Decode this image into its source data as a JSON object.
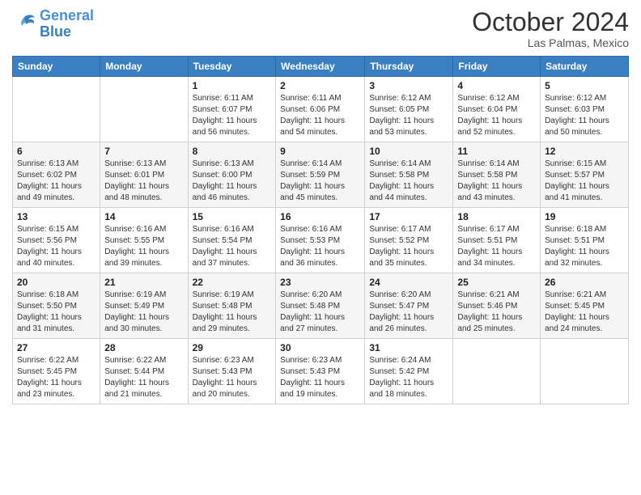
{
  "header": {
    "logo_line1": "General",
    "logo_line2": "Blue",
    "month": "October 2024",
    "location": "Las Palmas, Mexico"
  },
  "weekdays": [
    "Sunday",
    "Monday",
    "Tuesday",
    "Wednesday",
    "Thursday",
    "Friday",
    "Saturday"
  ],
  "weeks": [
    [
      {
        "day": "",
        "sunrise": "",
        "sunset": "",
        "daylight": ""
      },
      {
        "day": "",
        "sunrise": "",
        "sunset": "",
        "daylight": ""
      },
      {
        "day": "1",
        "sunrise": "Sunrise: 6:11 AM",
        "sunset": "Sunset: 6:07 PM",
        "daylight": "Daylight: 11 hours and 56 minutes."
      },
      {
        "day": "2",
        "sunrise": "Sunrise: 6:11 AM",
        "sunset": "Sunset: 6:06 PM",
        "daylight": "Daylight: 11 hours and 54 minutes."
      },
      {
        "day": "3",
        "sunrise": "Sunrise: 6:12 AM",
        "sunset": "Sunset: 6:05 PM",
        "daylight": "Daylight: 11 hours and 53 minutes."
      },
      {
        "day": "4",
        "sunrise": "Sunrise: 6:12 AM",
        "sunset": "Sunset: 6:04 PM",
        "daylight": "Daylight: 11 hours and 52 minutes."
      },
      {
        "day": "5",
        "sunrise": "Sunrise: 6:12 AM",
        "sunset": "Sunset: 6:03 PM",
        "daylight": "Daylight: 11 hours and 50 minutes."
      }
    ],
    [
      {
        "day": "6",
        "sunrise": "Sunrise: 6:13 AM",
        "sunset": "Sunset: 6:02 PM",
        "daylight": "Daylight: 11 hours and 49 minutes."
      },
      {
        "day": "7",
        "sunrise": "Sunrise: 6:13 AM",
        "sunset": "Sunset: 6:01 PM",
        "daylight": "Daylight: 11 hours and 48 minutes."
      },
      {
        "day": "8",
        "sunrise": "Sunrise: 6:13 AM",
        "sunset": "Sunset: 6:00 PM",
        "daylight": "Daylight: 11 hours and 46 minutes."
      },
      {
        "day": "9",
        "sunrise": "Sunrise: 6:14 AM",
        "sunset": "Sunset: 5:59 PM",
        "daylight": "Daylight: 11 hours and 45 minutes."
      },
      {
        "day": "10",
        "sunrise": "Sunrise: 6:14 AM",
        "sunset": "Sunset: 5:58 PM",
        "daylight": "Daylight: 11 hours and 44 minutes."
      },
      {
        "day": "11",
        "sunrise": "Sunrise: 6:14 AM",
        "sunset": "Sunset: 5:58 PM",
        "daylight": "Daylight: 11 hours and 43 minutes."
      },
      {
        "day": "12",
        "sunrise": "Sunrise: 6:15 AM",
        "sunset": "Sunset: 5:57 PM",
        "daylight": "Daylight: 11 hours and 41 minutes."
      }
    ],
    [
      {
        "day": "13",
        "sunrise": "Sunrise: 6:15 AM",
        "sunset": "Sunset: 5:56 PM",
        "daylight": "Daylight: 11 hours and 40 minutes."
      },
      {
        "day": "14",
        "sunrise": "Sunrise: 6:16 AM",
        "sunset": "Sunset: 5:55 PM",
        "daylight": "Daylight: 11 hours and 39 minutes."
      },
      {
        "day": "15",
        "sunrise": "Sunrise: 6:16 AM",
        "sunset": "Sunset: 5:54 PM",
        "daylight": "Daylight: 11 hours and 37 minutes."
      },
      {
        "day": "16",
        "sunrise": "Sunrise: 6:16 AM",
        "sunset": "Sunset: 5:53 PM",
        "daylight": "Daylight: 11 hours and 36 minutes."
      },
      {
        "day": "17",
        "sunrise": "Sunrise: 6:17 AM",
        "sunset": "Sunset: 5:52 PM",
        "daylight": "Daylight: 11 hours and 35 minutes."
      },
      {
        "day": "18",
        "sunrise": "Sunrise: 6:17 AM",
        "sunset": "Sunset: 5:51 PM",
        "daylight": "Daylight: 11 hours and 34 minutes."
      },
      {
        "day": "19",
        "sunrise": "Sunrise: 6:18 AM",
        "sunset": "Sunset: 5:51 PM",
        "daylight": "Daylight: 11 hours and 32 minutes."
      }
    ],
    [
      {
        "day": "20",
        "sunrise": "Sunrise: 6:18 AM",
        "sunset": "Sunset: 5:50 PM",
        "daylight": "Daylight: 11 hours and 31 minutes."
      },
      {
        "day": "21",
        "sunrise": "Sunrise: 6:19 AM",
        "sunset": "Sunset: 5:49 PM",
        "daylight": "Daylight: 11 hours and 30 minutes."
      },
      {
        "day": "22",
        "sunrise": "Sunrise: 6:19 AM",
        "sunset": "Sunset: 5:48 PM",
        "daylight": "Daylight: 11 hours and 29 minutes."
      },
      {
        "day": "23",
        "sunrise": "Sunrise: 6:20 AM",
        "sunset": "Sunset: 5:48 PM",
        "daylight": "Daylight: 11 hours and 27 minutes."
      },
      {
        "day": "24",
        "sunrise": "Sunrise: 6:20 AM",
        "sunset": "Sunset: 5:47 PM",
        "daylight": "Daylight: 11 hours and 26 minutes."
      },
      {
        "day": "25",
        "sunrise": "Sunrise: 6:21 AM",
        "sunset": "Sunset: 5:46 PM",
        "daylight": "Daylight: 11 hours and 25 minutes."
      },
      {
        "day": "26",
        "sunrise": "Sunrise: 6:21 AM",
        "sunset": "Sunset: 5:45 PM",
        "daylight": "Daylight: 11 hours and 24 minutes."
      }
    ],
    [
      {
        "day": "27",
        "sunrise": "Sunrise: 6:22 AM",
        "sunset": "Sunset: 5:45 PM",
        "daylight": "Daylight: 11 hours and 23 minutes."
      },
      {
        "day": "28",
        "sunrise": "Sunrise: 6:22 AM",
        "sunset": "Sunset: 5:44 PM",
        "daylight": "Daylight: 11 hours and 21 minutes."
      },
      {
        "day": "29",
        "sunrise": "Sunrise: 6:23 AM",
        "sunset": "Sunset: 5:43 PM",
        "daylight": "Daylight: 11 hours and 20 minutes."
      },
      {
        "day": "30",
        "sunrise": "Sunrise: 6:23 AM",
        "sunset": "Sunset: 5:43 PM",
        "daylight": "Daylight: 11 hours and 19 minutes."
      },
      {
        "day": "31",
        "sunrise": "Sunrise: 6:24 AM",
        "sunset": "Sunset: 5:42 PM",
        "daylight": "Daylight: 11 hours and 18 minutes."
      },
      {
        "day": "",
        "sunrise": "",
        "sunset": "",
        "daylight": ""
      },
      {
        "day": "",
        "sunrise": "",
        "sunset": "",
        "daylight": ""
      }
    ]
  ]
}
